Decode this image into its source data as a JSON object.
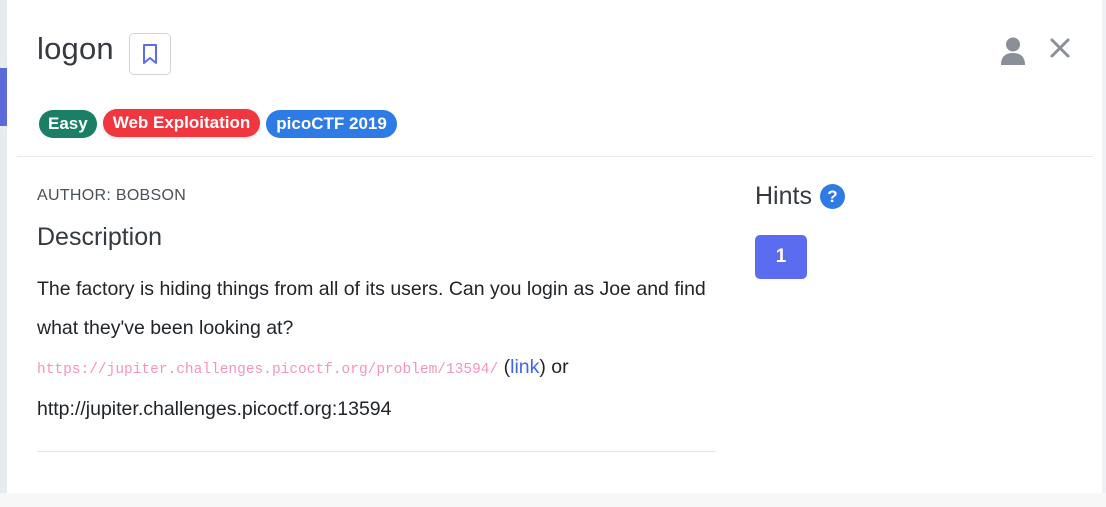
{
  "challenge": {
    "title": "logon",
    "tags": [
      "Easy",
      "Web Exploitation",
      "picoCTF 2019"
    ],
    "author": "AUTHOR: BOBSON",
    "description_heading": "Description",
    "description_text": "The factory is hiding things from all of its users. Can you login as Joe and find what they've been looking at?",
    "code_url": "https://jupiter.challenges.picoctf.org/problem/13594/",
    "link_open": "(",
    "link_label": "link",
    "link_close_or": ") or",
    "plain_url": "http://jupiter.challenges.picoctf.org:13594"
  },
  "hints": {
    "title": "Hints",
    "help_glyph": "?",
    "items": [
      "1"
    ]
  },
  "icons": {
    "bookmark": "bookmark-icon",
    "user": "user-icon",
    "close": "close-icon"
  },
  "colors": {
    "easy": "#1a7f64",
    "web": "#f0363e",
    "pico": "#2f7be5",
    "hint_button": "#5b6cf1",
    "link": "#4263eb",
    "code": "#e83e8c"
  }
}
